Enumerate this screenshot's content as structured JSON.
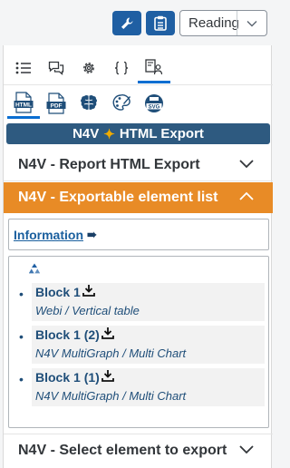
{
  "toolbar": {
    "wrench_icon": "wrench-icon",
    "clipboard_icon": "clipboard-icon",
    "view_mode": "Reading"
  },
  "tabs_top": [
    "list-icon",
    "comments-icon",
    "gear-icon",
    "braces-icon",
    "export-user-icon"
  ],
  "tabs_format": [
    "HTML",
    "PDF",
    "brain-icon",
    "palette-icon",
    "SVG"
  ],
  "title": {
    "left": "N4V",
    "right": "HTML Export"
  },
  "accordion": {
    "report_export": "N4V - Report HTML Export",
    "element_list": "N4V - Exportable element list",
    "select_element": "N4V - Select element to export"
  },
  "info": {
    "link": "Information"
  },
  "items": [
    {
      "name": "Block 1",
      "sub": "Webi / Vertical table"
    },
    {
      "name": "Block 1 (2)",
      "sub": "N4V MultiGraph / Multi Chart"
    },
    {
      "name": "Block 1 (1)",
      "sub": "N4V MultiGraph / Multi Chart"
    }
  ],
  "colors": {
    "primary": "#1f5fa3",
    "title_bar": "#2e5a80",
    "active_section": "#e88b26",
    "link": "#1a5f9e"
  }
}
